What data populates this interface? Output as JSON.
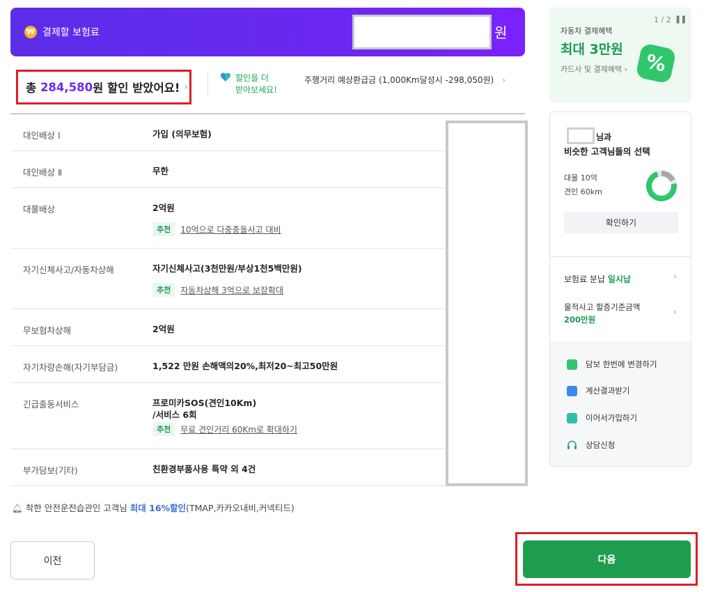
{
  "header": {
    "icon": "won-coin-icon",
    "title": "결제할 보험료",
    "amount_suffix": "원"
  },
  "discount": {
    "prefix": "총 ",
    "amount": "284,580",
    "suffix": "원 할인 받았어요!",
    "chevron": "›"
  },
  "more_discount": {
    "line1": "할인을 더",
    "line2": "받아보세요!",
    "icon": "heart-icon"
  },
  "refund": {
    "text": "주행거리 예상환급금 (1,000Km달성시 -298,050원)",
    "chevron": "›"
  },
  "coverages": [
    {
      "label": "대인배상 Ⅰ",
      "value": "가입 (의무보험)"
    },
    {
      "label": "대인배상 Ⅱ",
      "value": "무한"
    },
    {
      "label": "대물배상",
      "value": "2억원",
      "rec_tag": "추천",
      "rec_link": "10억으로 다중충돌사고 대비"
    },
    {
      "label": "자기신체사고/자동차상해",
      "value": "자기신체사고(3천만원/부상1천5백만원)",
      "rec_tag": "추천",
      "rec_link": "자동차상해 3억으로 보장확대"
    },
    {
      "label": "무보험차상해",
      "value": "2억원"
    },
    {
      "label": "자기차량손해(자기부담금)",
      "value": "1,522 만원 손해액의20%,최저20~최고50만원"
    },
    {
      "label": "긴급출동서비스",
      "value_line1": "프로미카SOS(견인10Km)",
      "value_line2": "/서비스 6회",
      "rec_tag": "추천",
      "rec_link": "무료 견인거리 60Km로 확대하기"
    },
    {
      "label": "부가담보(기타)",
      "value": "친환경부품사용 특약 외 4건"
    }
  ],
  "notice": {
    "prefix": "착한 안전운전습관인 고객님 ",
    "highlight": "최대 16%할인",
    "suffix": "(TMAP,카카오내비,커넥티드)",
    "icon": "bell-icon"
  },
  "buttons": {
    "prev": "이전",
    "next": "다음"
  },
  "promo": {
    "page": "1 / 2",
    "line1": "자동차 결제혜택",
    "line2": "최대 3만원",
    "line3": "카드사 및 결제혜택 ›",
    "badge": "%"
  },
  "side_card": {
    "name_suffix": "님과",
    "subtitle": "비슷한 고객님들의 선택",
    "stat1": "대물 10억",
    "stat2": "견인 60km",
    "confirm": "확인하기",
    "installment_prefix": "보험료 분납 ",
    "installment_value": "일시납",
    "threshold_label": "물적사고 할증기준금액",
    "threshold_value": "200만원",
    "actions": [
      {
        "icon": "change-coverage-icon",
        "label": "담보 한번에 변경하기",
        "color": "#2fc76a"
      },
      {
        "icon": "download-result-icon",
        "label": "계산결과받기",
        "color": "#3a8be8"
      },
      {
        "icon": "continue-signup-icon",
        "label": "이어서가입하기",
        "color": "#2fbfa8"
      },
      {
        "icon": "headset-icon",
        "label": "상담신청",
        "color": "#1fa87a"
      }
    ]
  }
}
